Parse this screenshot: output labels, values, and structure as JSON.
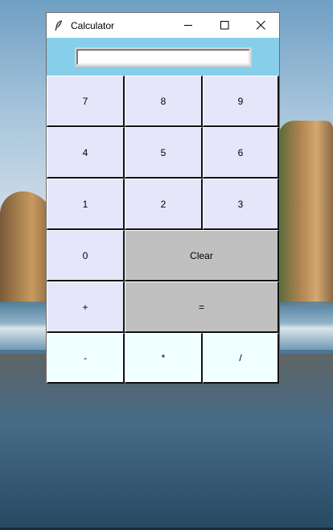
{
  "window": {
    "title": "Calculator",
    "icon": "feather-icon"
  },
  "controls": {
    "minimize": "minimize-icon",
    "maximize": "maximize-icon",
    "close": "close-icon"
  },
  "display": {
    "value": ""
  },
  "buttons": {
    "b7": "7",
    "b8": "8",
    "b9": "9",
    "b4": "4",
    "b5": "5",
    "b6": "6",
    "b1": "1",
    "b2": "2",
    "b3": "3",
    "b0": "0",
    "clear": "Clear",
    "plus": "+",
    "equals": "=",
    "minus": "-",
    "multiply": "*",
    "divide": "/"
  },
  "colors": {
    "window_bg": "#87ceeb",
    "number_buttons": "#e6e6fa",
    "operator_buttons": "#c0c0c0",
    "bottom_row_buttons": "#f0ffff"
  }
}
